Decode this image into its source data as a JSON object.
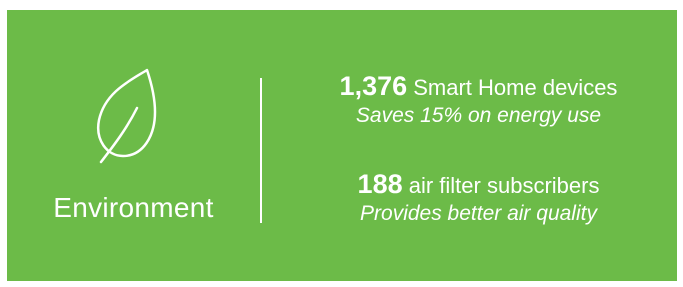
{
  "panel": {
    "background_color": "#6cbb48",
    "text_color": "#ffffff",
    "icon": "leaf-icon",
    "category": "Environment"
  },
  "stats": [
    {
      "number": "1,376",
      "label": "Smart Home devices",
      "subtitle": "Saves 15% on energy use"
    },
    {
      "number": "188",
      "label": "air filter subscribers",
      "subtitle": "Provides better air quality"
    }
  ]
}
